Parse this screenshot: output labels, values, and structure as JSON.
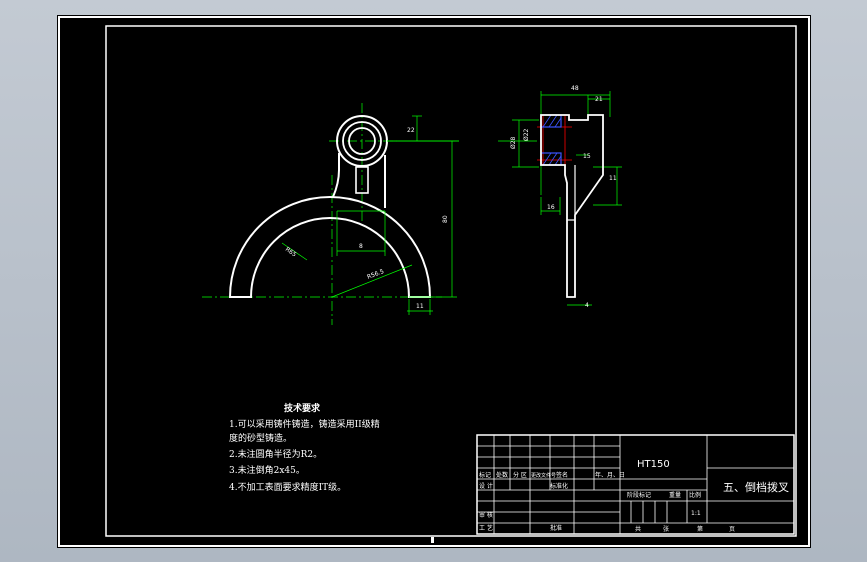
{
  "colors": {
    "background": "#000000",
    "geometry": "#ffffff",
    "dimension": "#00ff00",
    "centerline": "#00ff00",
    "hidden": "#ff0000",
    "hatch": "#3b54ff",
    "frame": "#ffffff"
  },
  "front_view": {
    "dim_hub_top": "22",
    "dim_height": "80",
    "dim_slot": "8",
    "dim_radius_outer": "R65",
    "dim_radius_inner": "R56.5",
    "dim_width": "11"
  },
  "side_view": {
    "dim_top_width": "48",
    "dim_right": "21",
    "dim_bore": "Ø22",
    "dim_hub_len": "16",
    "dim_step": "15",
    "dim_rib": "11",
    "dim_thickness": "4",
    "dim_left": "Ø28"
  },
  "tech_requirements": {
    "title": "技术要求",
    "line1": "1.可以采用铸件铸造，铸造采用II级精",
    "line2": "度的砂型铸造。",
    "line3": "2.未注圆角半径为R2。",
    "line4": "3.未注倒角2x45。",
    "line5": "4.不加工表面要求精度IT级。"
  },
  "title_block": {
    "material": "HT150",
    "part_name": "五、倒档拨叉",
    "scale": "1:1",
    "row_marks": "标记",
    "row_count": "处数",
    "row_zone": "分 区",
    "row_docno": "更改文件号",
    "row_sign": "签名",
    "row_date": "年、月、日",
    "designer": "设 计",
    "standardize": "标准化",
    "review": "审 核",
    "process": "工 艺",
    "approve": "批准",
    "stage_mark": "阶段标记",
    "weight": "重量",
    "ratio": "比例",
    "total": "共",
    "sheet": "张",
    "page": "第",
    "page_unit": "页"
  }
}
